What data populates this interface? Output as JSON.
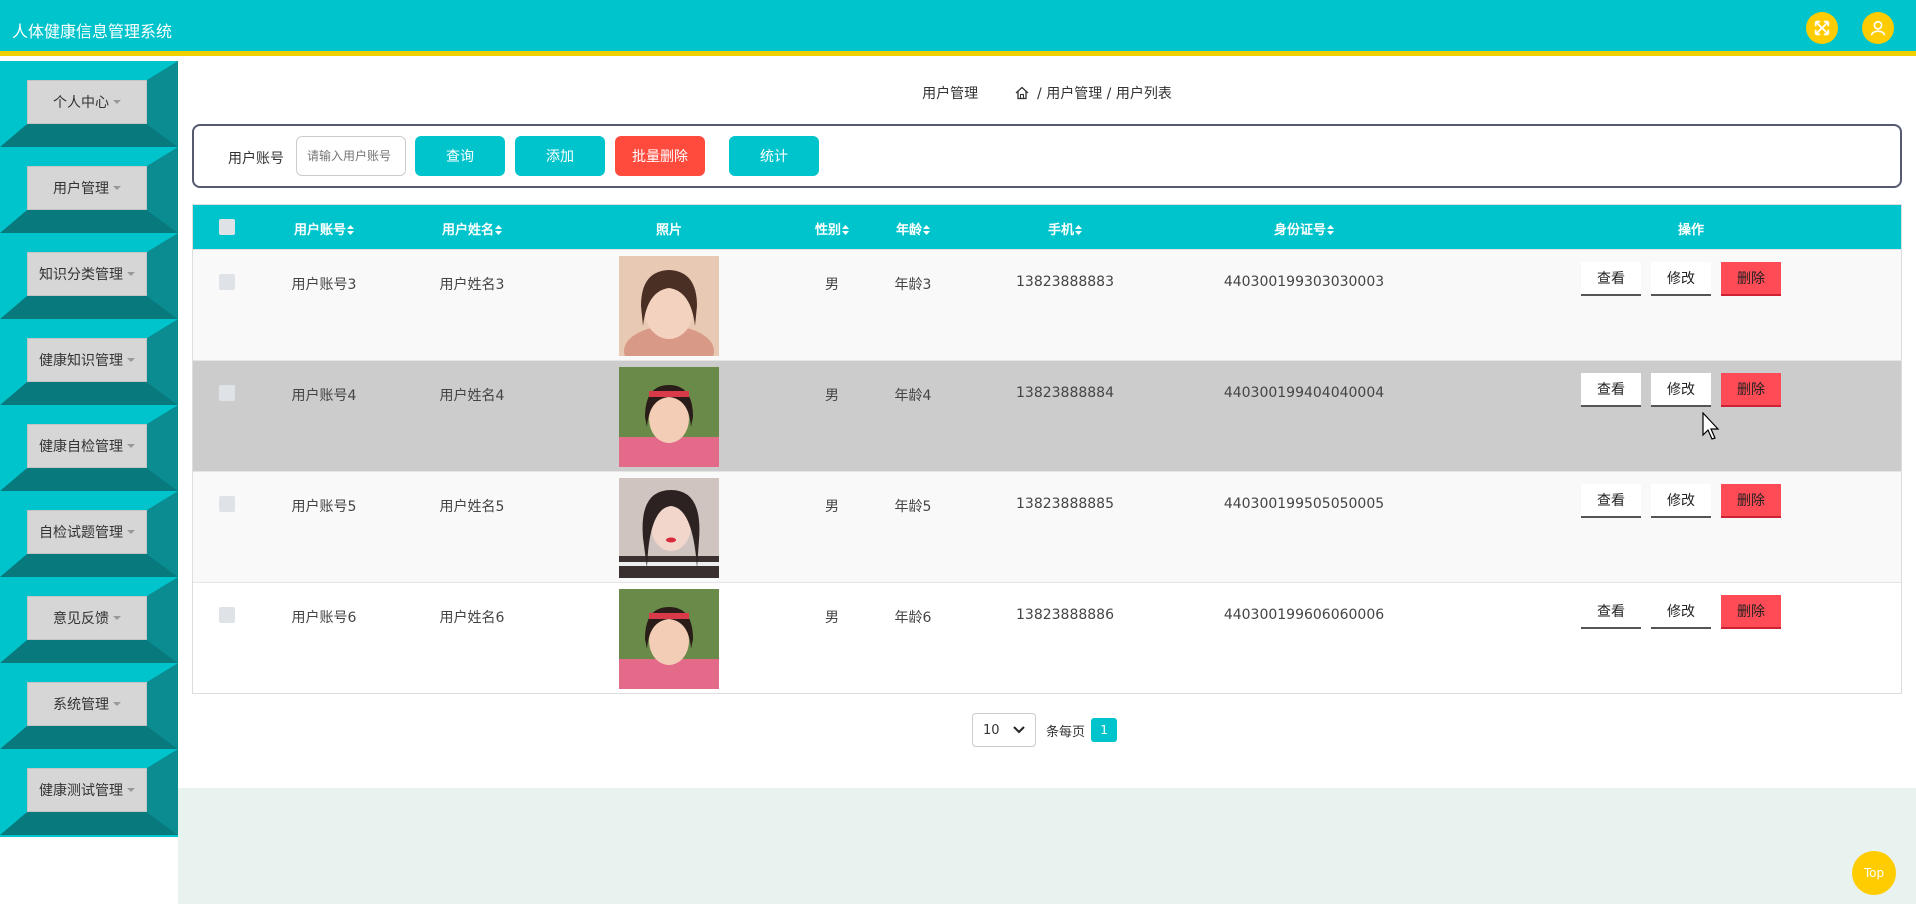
{
  "header": {
    "title": "人体健康信息管理系统",
    "icons": [
      "fullscreen-icon",
      "user-icon"
    ],
    "colors": {
      "primary": "#00c4cc",
      "accent": "#ffcc00",
      "danger": "#ff4b3e"
    }
  },
  "sidebar": {
    "items": [
      {
        "label": "个人中心"
      },
      {
        "label": "用户管理"
      },
      {
        "label": "知识分类管理"
      },
      {
        "label": "健康知识管理"
      },
      {
        "label": "健康自检管理"
      },
      {
        "label": "自检试题管理"
      },
      {
        "label": "意见反馈"
      },
      {
        "label": "系统管理"
      },
      {
        "label": "健康测试管理"
      }
    ]
  },
  "breadcrumb": {
    "title": "用户管理",
    "path": "/ 用户管理 / 用户列表"
  },
  "search": {
    "label": "用户账号",
    "placeholder": "请输入用户账号",
    "query_label": "查询",
    "add_label": "添加",
    "batch_delete_label": "批量删除",
    "stats_label": "统计"
  },
  "table": {
    "headers": {
      "account": "用户账号",
      "name": "用户姓名",
      "photo": "照片",
      "gender": "性别",
      "age": "年龄",
      "phone": "手机",
      "id_card": "身份证号",
      "actions": "操作"
    },
    "rows": [
      {
        "account": "用户账号3",
        "name": "用户姓名3",
        "gender": "男",
        "age": "年龄3",
        "phone": "13823888883",
        "id_card": "440300199303030003"
      },
      {
        "account": "用户账号4",
        "name": "用户姓名4",
        "gender": "男",
        "age": "年龄4",
        "phone": "13823888884",
        "id_card": "440300199404040004"
      },
      {
        "account": "用户账号5",
        "name": "用户姓名5",
        "gender": "男",
        "age": "年龄5",
        "phone": "13823888885",
        "id_card": "440300199505050005"
      },
      {
        "account": "用户账号6",
        "name": "用户姓名6",
        "gender": "男",
        "age": "年龄6",
        "phone": "13823888886",
        "id_card": "440300199606060006"
      }
    ],
    "action_labels": {
      "view": "查看",
      "edit": "修改",
      "delete": "删除"
    }
  },
  "pagination": {
    "page_size": "10",
    "per_page_label": "条每页",
    "current_page": "1"
  },
  "back_to_top": "Top"
}
